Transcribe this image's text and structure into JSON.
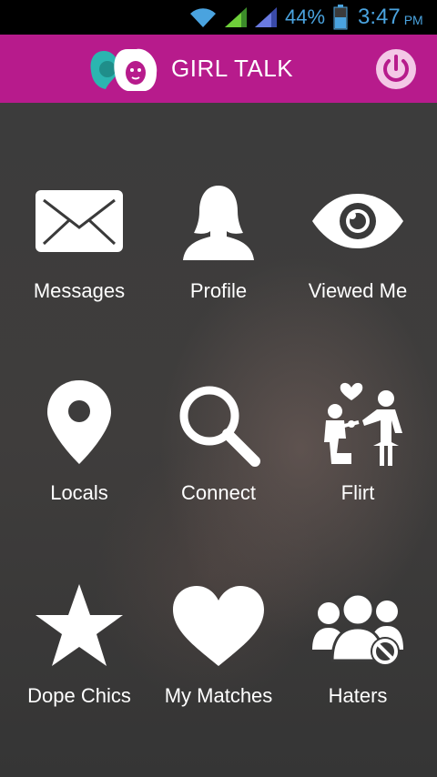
{
  "status_bar": {
    "battery": "44%",
    "time": "3:47",
    "ampm": "PM",
    "icons": [
      "wifi-icon",
      "signal-icon",
      "signal-icon",
      "battery-icon"
    ]
  },
  "app_bar": {
    "title": "GIRL TALK",
    "color": "#b71b8c",
    "logo_icon": "girls-logo-icon",
    "power_icon": "power-icon"
  },
  "menu": {
    "items": [
      {
        "label": "Messages",
        "icon": "envelope-icon"
      },
      {
        "label": "Profile",
        "icon": "person-silhouette-icon"
      },
      {
        "label": "Viewed Me",
        "icon": "eye-icon"
      },
      {
        "label": "Locals",
        "icon": "map-pin-icon"
      },
      {
        "label": "Connect",
        "icon": "magnifier-icon"
      },
      {
        "label": "Flirt",
        "icon": "proposal-icon"
      },
      {
        "label": "Dope Chics",
        "icon": "star-icon"
      },
      {
        "label": "My Matches",
        "icon": "heart-icon"
      },
      {
        "label": "Haters",
        "icon": "blocked-users-icon"
      }
    ]
  }
}
